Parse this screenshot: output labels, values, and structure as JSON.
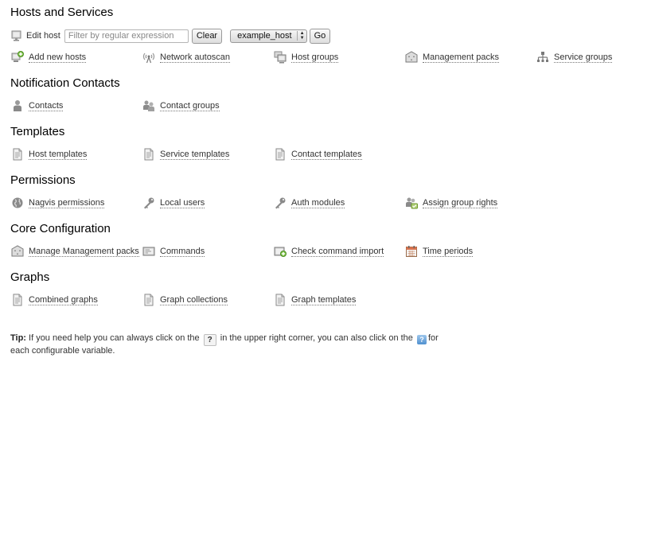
{
  "sections": {
    "hosts_services": {
      "title": "Hosts and Services",
      "edit_host_label": "Edit host",
      "filter_placeholder": "Filter by regular expression",
      "clear_label": "Clear",
      "host_select_value": "example_host",
      "go_label": "Go",
      "links": [
        {
          "label": "Add new hosts",
          "icon": "add-host-icon"
        },
        {
          "label": "Network autoscan",
          "icon": "antenna-icon"
        },
        {
          "label": "Host groups",
          "icon": "host-group-icon"
        },
        {
          "label": "Management packs",
          "icon": "management-pack-icon"
        },
        {
          "label": "Service groups",
          "icon": "service-tree-icon"
        }
      ]
    },
    "notification_contacts": {
      "title": "Notification Contacts",
      "links": [
        {
          "label": "Contacts",
          "icon": "person-icon"
        },
        {
          "label": "Contact groups",
          "icon": "people-icon"
        }
      ]
    },
    "templates": {
      "title": "Templates",
      "links": [
        {
          "label": "Host templates",
          "icon": "document-icon"
        },
        {
          "label": "Service templates",
          "icon": "document-icon"
        },
        {
          "label": "Contact templates",
          "icon": "document-icon"
        }
      ]
    },
    "permissions": {
      "title": "Permissions",
      "links": [
        {
          "label": "Nagvis permissions",
          "icon": "globe-icon"
        },
        {
          "label": "Local users",
          "icon": "key-icon"
        },
        {
          "label": "Auth modules",
          "icon": "key-icon"
        },
        {
          "label": "Assign group rights",
          "icon": "group-rights-icon"
        }
      ]
    },
    "core_configuration": {
      "title": "Core Configuration",
      "links": [
        {
          "label": "Manage Management packs",
          "icon": "management-pack-icon"
        },
        {
          "label": "Commands",
          "icon": "terminal-icon"
        },
        {
          "label": "Check command import",
          "icon": "import-icon"
        },
        {
          "label": "Time periods",
          "icon": "calendar-icon"
        }
      ]
    },
    "graphs": {
      "title": "Graphs",
      "links": [
        {
          "label": "Combined graphs",
          "icon": "document-icon"
        },
        {
          "label": "Graph collections",
          "icon": "document-icon"
        },
        {
          "label": "Graph templates",
          "icon": "document-icon"
        }
      ]
    }
  },
  "tip": {
    "prefix": "Tip:",
    "text_1": " If you need help you can always click on the ",
    "help_glyph": "?",
    "text_2": " in the upper right corner, you can also click on the ",
    "text_3": "for each configurable variable."
  }
}
